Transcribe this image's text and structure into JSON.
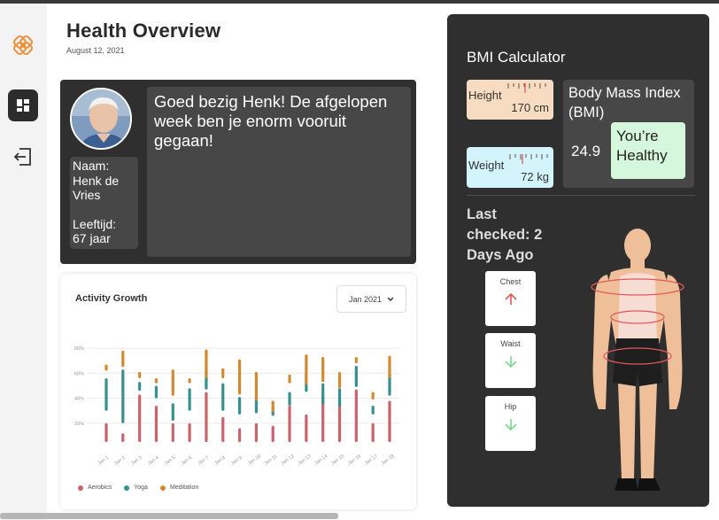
{
  "header": {
    "title": "Health Overview",
    "date": "August 12, 2021"
  },
  "sidebar": {
    "items": [
      {
        "icon": "logo-icon"
      },
      {
        "icon": "dashboard-icon"
      },
      {
        "icon": "logout-icon"
      }
    ]
  },
  "profile": {
    "name_label": "Naam:",
    "name_value": "Henk de Vries",
    "age_label": "Leeftijd:",
    "age_value": "67 jaar",
    "message": "Goed bezig Henk! De afgelopen week ben je enorm vooruit gegaan!"
  },
  "activity": {
    "title": "Activity Growth",
    "month_select": "Jan 2021",
    "legend": [
      "Aerobics",
      "Yoga",
      "Meditation"
    ]
  },
  "chart_data": {
    "type": "bar",
    "title": "Activity Growth",
    "categories": [
      "Jan 1",
      "Jan 2",
      "Jan 3",
      "Jan 4",
      "Jan 5",
      "Jan 6",
      "Jan 7",
      "Jan 8",
      "Jan 9",
      "Jan 10",
      "Jan 11",
      "Jan 12",
      "Jan 13",
      "Jan 14",
      "Jan 15",
      "Jan 16",
      "Jan 17",
      "Jan 18"
    ],
    "y_ticks": [
      "20%",
      "40%",
      "60%",
      "80%"
    ],
    "ylim": [
      0,
      90
    ],
    "grid": true,
    "legend_position": "bottom-left",
    "series": [
      {
        "name": "Aerobics",
        "values": [
          [
            5,
            20
          ],
          [
            5,
            12
          ],
          [
            5,
            43
          ],
          [
            5,
            34
          ],
          [
            5,
            20
          ],
          [
            5,
            20
          ],
          [
            5,
            45
          ],
          [
            5,
            25
          ],
          [
            5,
            16
          ],
          [
            5,
            20
          ],
          [
            5,
            18
          ],
          [
            5,
            34
          ],
          [
            5,
            27
          ],
          [
            5,
            42
          ],
          [
            5,
            40
          ],
          [
            5,
            47
          ],
          [
            5,
            20
          ],
          [
            5,
            38
          ]
        ]
      },
      {
        "name": "Yoga",
        "values": [
          [
            30,
            56
          ],
          [
            20,
            63
          ],
          [
            46,
            53
          ],
          [
            40,
            50
          ],
          [
            22,
            36
          ],
          [
            30,
            48
          ],
          [
            47,
            66
          ],
          [
            30,
            52
          ],
          [
            27,
            41
          ],
          [
            28,
            39
          ],
          [
            26,
            33
          ],
          [
            34,
            45
          ],
          [
            45,
            60
          ],
          [
            35,
            52
          ],
          [
            33,
            48
          ],
          [
            49,
            66
          ],
          [
            27,
            34
          ],
          [
            42,
            61
          ]
        ]
      },
      {
        "name": "Meditation",
        "values": [
          [
            62,
            67
          ],
          [
            65,
            78
          ],
          [
            56,
            61
          ],
          [
            52,
            56
          ],
          [
            42,
            63
          ],
          [
            52,
            56
          ],
          [
            56,
            79
          ],
          [
            56,
            64
          ],
          [
            43,
            71
          ],
          [
            38,
            61
          ],
          [
            29,
            38
          ],
          [
            52,
            59
          ],
          [
            51,
            75
          ],
          [
            53,
            73
          ],
          [
            48,
            61
          ],
          [
            68,
            73
          ],
          [
            39,
            45
          ],
          [
            56,
            74
          ]
        ]
      }
    ]
  },
  "bmi": {
    "title": "BMI Calculator",
    "height_label": "Height",
    "height_value": "170 cm",
    "weight_label": "Weight",
    "weight_value": "72 kg",
    "bmi_label": "Body Mass Index (BMI)",
    "bmi_value": "24.9",
    "status": "You’re Healthy",
    "last_checked": "Last checked: 2 Days Ago",
    "measures": [
      {
        "label": "Chest",
        "trend": "up"
      },
      {
        "label": "Waist",
        "trend": "down"
      },
      {
        "label": "Hip",
        "trend": "down"
      }
    ]
  },
  "colors": {
    "aerobics": "#c9646b",
    "yoga": "#37908f",
    "meditation": "#d3892f",
    "up": "#e05a5a",
    "down": "#7dd68d",
    "dark_panel": "#2f2f2f",
    "height_card": "#f8dcc1",
    "weight_card": "#d3f4fa",
    "healthy_card": "#d5f8dd"
  }
}
